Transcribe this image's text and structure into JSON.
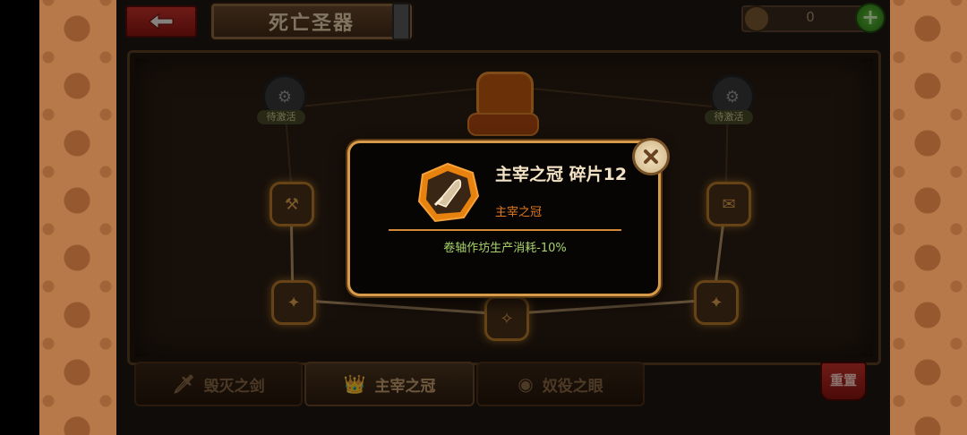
{
  "header": {
    "title": "死亡圣器",
    "currency_value": "0",
    "plus_label": "+"
  },
  "board": {
    "locked_tag_left": "待激活",
    "locked_tag_right": "待激活"
  },
  "tabs": [
    {
      "label": "毁灭之剑",
      "icon": "sword-icon",
      "active": false
    },
    {
      "label": "主宰之冠",
      "icon": "crown-icon",
      "active": true
    },
    {
      "label": "奴役之眼",
      "icon": "eye-icon",
      "active": false
    }
  ],
  "reset_label": "重置",
  "modal": {
    "title": "主宰之冠 碎片12",
    "subtitle": "主宰之冠",
    "effect": "卷轴作坊生产消耗-10%",
    "icon": "crown-shard-icon"
  },
  "colors": {
    "modal_border": "#d79a48",
    "subtitle": "#e27a22",
    "effect": "#a8d36a",
    "title": "#f3e3c4"
  }
}
